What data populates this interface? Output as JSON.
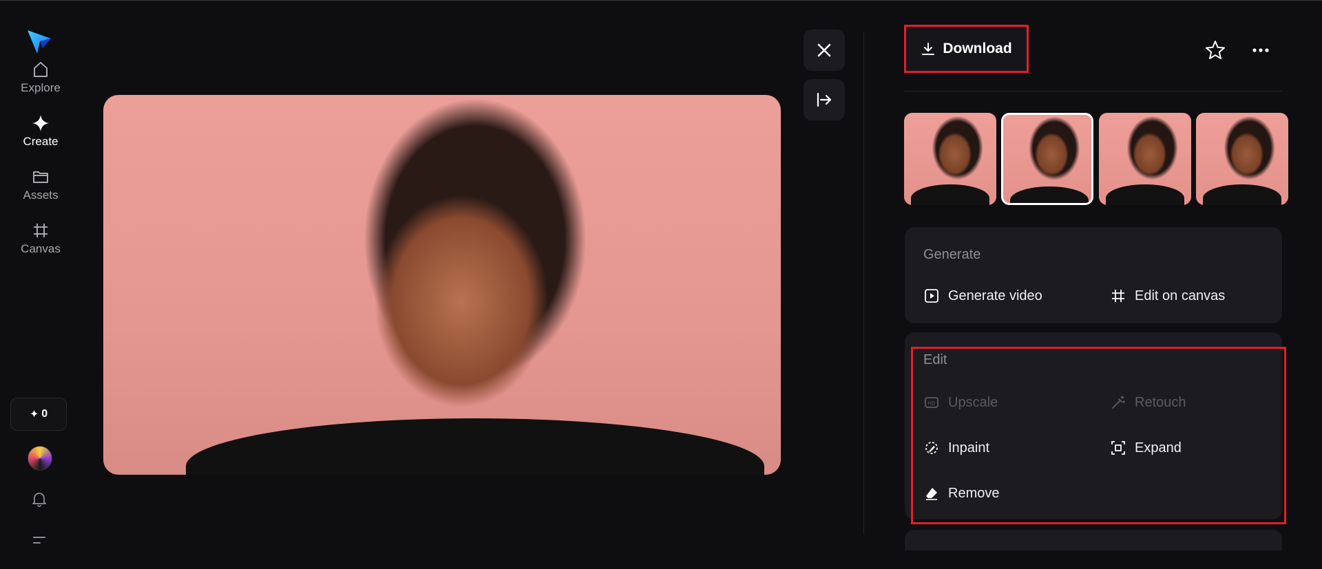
{
  "sidebar": {
    "logo": "app-logo-star",
    "items": [
      {
        "label": "Explore",
        "icon": "home-icon",
        "active": false
      },
      {
        "label": "Create",
        "icon": "sparkle-icon",
        "active": true
      },
      {
        "label": "Assets",
        "icon": "folder-icon",
        "active": false
      },
      {
        "label": "Canvas",
        "icon": "canvas-grid-icon",
        "active": false
      }
    ],
    "credits": {
      "symbol": "✦",
      "count": "0"
    }
  },
  "viewer": {
    "close_icon": "close-icon",
    "collapse_icon": "arrow-right-bar-icon"
  },
  "panel": {
    "download_label": "Download",
    "thumbnails_selected_index": 1,
    "generate": {
      "title": "Generate",
      "actions": [
        {
          "label": "Generate video",
          "icon": "play-square-icon",
          "enabled": true
        },
        {
          "label": "Edit on canvas",
          "icon": "canvas-grid-icon",
          "enabled": true
        }
      ]
    },
    "edit": {
      "title": "Edit",
      "actions": [
        {
          "label": "Upscale",
          "icon": "hd-icon",
          "enabled": false
        },
        {
          "label": "Retouch",
          "icon": "magic-wand-icon",
          "enabled": false
        },
        {
          "label": "Inpaint",
          "icon": "inpaint-brush-icon",
          "enabled": true
        },
        {
          "label": "Expand",
          "icon": "expand-frame-icon",
          "enabled": true
        },
        {
          "label": "Remove",
          "icon": "eraser-icon",
          "enabled": true
        }
      ]
    }
  },
  "colors": {
    "background": "#0e0e10",
    "card": "#1b1b20",
    "highlight": "#e0202a",
    "accent_logo": "#2aa8ff"
  }
}
